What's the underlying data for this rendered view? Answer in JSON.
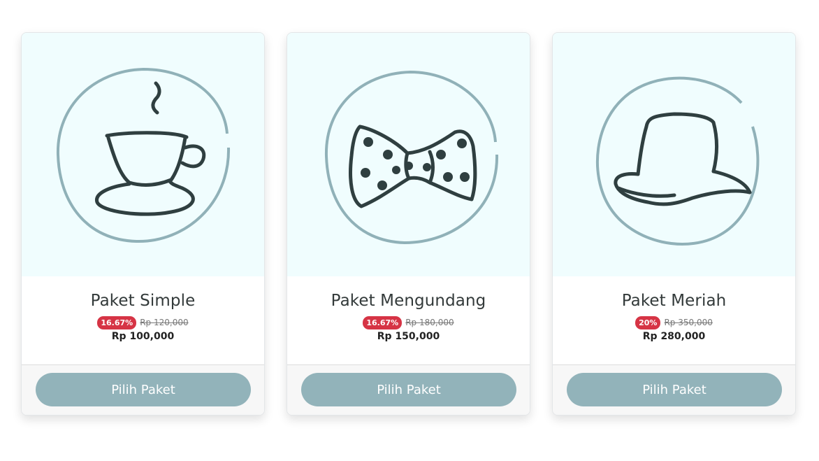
{
  "packages": [
    {
      "title": "Paket Simple",
      "discount": "16.67%",
      "old_price": "Rp 120,000",
      "price": "Rp 100,000",
      "button": "Pilih Paket",
      "icon": "teacup-icon"
    },
    {
      "title": "Paket Mengundang",
      "discount": "16.67%",
      "old_price": "Rp 180,000",
      "price": "Rp 150,000",
      "button": "Pilih Paket",
      "icon": "bowtie-icon"
    },
    {
      "title": "Paket Meriah",
      "discount": "20%",
      "old_price": "Rp 350,000",
      "price": "Rp 280,000",
      "button": "Pilih Paket",
      "icon": "hat-icon"
    }
  ],
  "colors": {
    "accent": "#92b3ba",
    "badge": "#d63445",
    "illustration_bg": "#f0fdfe"
  }
}
